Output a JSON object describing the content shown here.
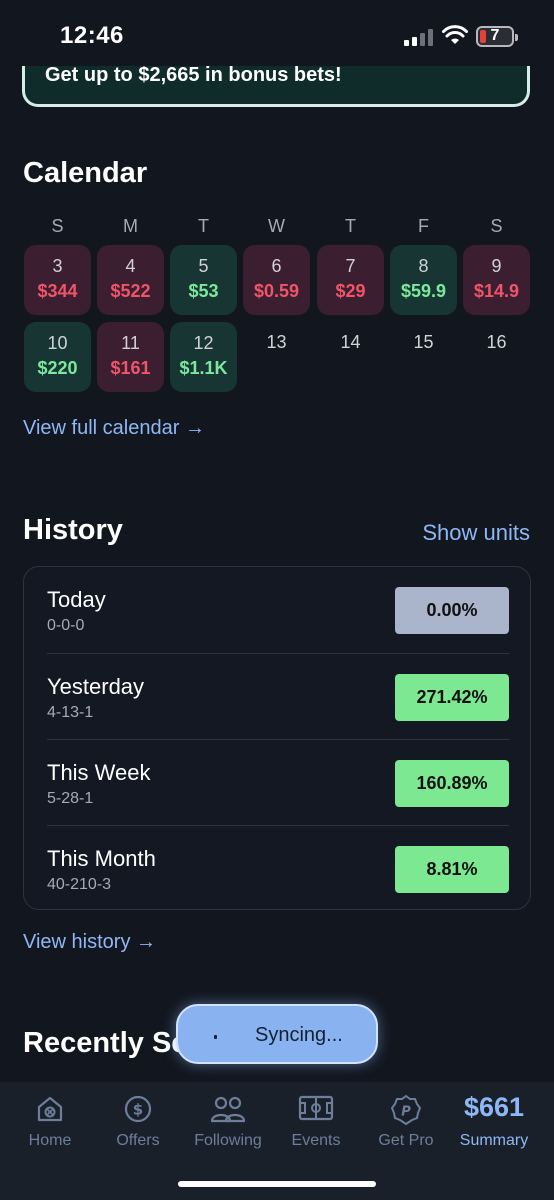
{
  "status": {
    "time": "12:46",
    "battery": "7"
  },
  "promo": {
    "text": "Get up to $2,665 in bonus bets!"
  },
  "calendar": {
    "title": "Calendar",
    "weekdays": [
      "S",
      "M",
      "T",
      "W",
      "T",
      "F",
      "S"
    ],
    "days": [
      {
        "num": "3",
        "amount": "$344",
        "result": "loss"
      },
      {
        "num": "4",
        "amount": "$522",
        "result": "loss"
      },
      {
        "num": "5",
        "amount": "$53",
        "result": "win"
      },
      {
        "num": "6",
        "amount": "$0.59",
        "result": "loss"
      },
      {
        "num": "7",
        "amount": "$29",
        "result": "loss"
      },
      {
        "num": "8",
        "amount": "$59.9",
        "result": "win"
      },
      {
        "num": "9",
        "amount": "$14.9",
        "result": "loss"
      },
      {
        "num": "10",
        "amount": "$220",
        "result": "win"
      },
      {
        "num": "11",
        "amount": "$161",
        "result": "loss"
      },
      {
        "num": "12",
        "amount": "$1.1K",
        "result": "win"
      },
      {
        "num": "13",
        "amount": "",
        "result": "none"
      },
      {
        "num": "14",
        "amount": "",
        "result": "none"
      },
      {
        "num": "15",
        "amount": "",
        "result": "none"
      },
      {
        "num": "16",
        "amount": "",
        "result": "none"
      }
    ],
    "view_full": "View full calendar →"
  },
  "history": {
    "title": "History",
    "show_units": "Show units",
    "rows": [
      {
        "label": "Today",
        "record": "0-0-0",
        "roi": "0.00%",
        "tone": "neutral"
      },
      {
        "label": "Yesterday",
        "record": "4-13-1",
        "roi": "271.42%",
        "tone": "positive"
      },
      {
        "label": "This Week",
        "record": "5-28-1",
        "roi": "160.89%",
        "tone": "positive"
      },
      {
        "label": "This Month",
        "record": "40-210-3",
        "roi": "8.81%",
        "tone": "positive"
      }
    ],
    "view_history": "View history  →"
  },
  "recently": {
    "title": "Recently Se"
  },
  "sync": {
    "text": "Syncing..."
  },
  "tabs": [
    {
      "label": "Home",
      "icon": "home-icon"
    },
    {
      "label": "Offers",
      "icon": "dollar-coin-icon"
    },
    {
      "label": "Following",
      "icon": "users-icon"
    },
    {
      "label": "Events",
      "icon": "stadium-icon"
    },
    {
      "label": "Get Pro",
      "icon": "pro-badge-icon"
    },
    {
      "label": "Summary",
      "value": "$661",
      "active": true
    }
  ],
  "colors": {
    "background": "#12161f",
    "accent": "#8fb7f5",
    "win": "#7be89c",
    "loss": "#f0546a"
  }
}
